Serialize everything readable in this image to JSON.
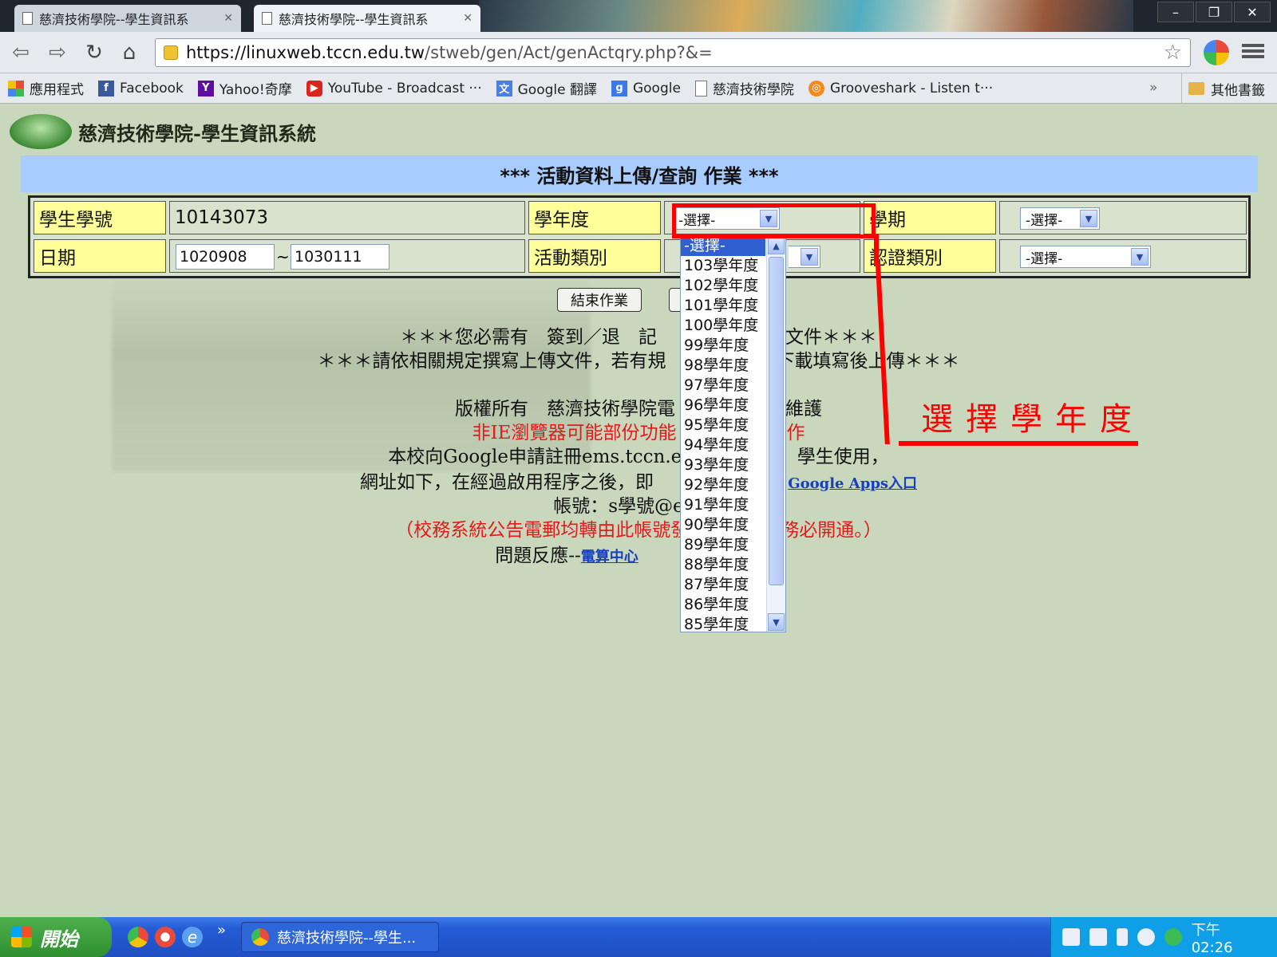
{
  "browser": {
    "tabs": [
      {
        "title": "慈濟技術學院--學生資訊系"
      },
      {
        "title": "慈濟技術學院--學生資訊系"
      }
    ],
    "window_controls": {
      "minimize": "–",
      "restore": "❐",
      "close": "✕"
    },
    "url_host": "https://linuxweb.tccn.edu.tw",
    "url_path": "/stweb/gen/Act/genActqry.php?&=",
    "bookmarks": [
      {
        "label": "應用程式",
        "icon": "apps-icon"
      },
      {
        "label": "Facebook",
        "icon": "facebook-icon"
      },
      {
        "label": "Yahoo!奇摩",
        "icon": "yahoo-icon"
      },
      {
        "label": "YouTube - Broadcast ···",
        "icon": "youtube-icon"
      },
      {
        "label": "Google 翻譯",
        "icon": "google-translate-icon"
      },
      {
        "label": "Google",
        "icon": "google-icon"
      },
      {
        "label": "慈濟技術學院",
        "icon": "page-icon"
      },
      {
        "label": "Grooveshark - Listen t···",
        "icon": "grooveshark-icon"
      }
    ],
    "bookmarks_more": "»",
    "other_bookmarks": "其他書籤"
  },
  "page": {
    "site_title": "慈濟技術學院-學生資訊系統",
    "banner": "*** 活動資料上傳/查詢 作業 ***",
    "form": {
      "student_id_label": "學生學號",
      "student_id_value": "10143073",
      "year_label": "學年度",
      "year_select": "-選擇-",
      "semester_label": "學期",
      "semester_select": "-選擇-",
      "date_label": "日期",
      "date_from": "1020908",
      "date_sep": "~",
      "date_to": "1030111",
      "activity_label": "活動類別",
      "cert_label": "認證類別",
      "cert_select": "-選擇-"
    },
    "end_button": "結束作業",
    "lines": {
      "l1": "＊＊＊您必需有　簽到／退　記　　　　　　　文件＊＊＊",
      "l2": "＊＊＊請依相關規定撰寫上傳文件，若有規　　　　　　下載填寫後上傳＊＊＊",
      "l3": "版權所有　慈濟技術學院電　　　　　　維護",
      "l4": "非IE瀏覽器可能部份功能　　　　　　作",
      "l5": "本校向Google申請註冊ems.tccn.edu　　　　　學生使用，",
      "l6": "網址如下，在經過啟用程序之後，即　　　　　　，",
      "l6_link": "Google Apps入口",
      "l7": "帳號：s學號@ems.t",
      "l8": "（校務系統公告電郵均轉由此帳號發　　　　　務必開通。）",
      "l9": "問題反應--",
      "l9_link": "電算中心"
    },
    "dropdown_options": [
      "-選擇-",
      "103學年度",
      "102學年度",
      "101學年度",
      "100學年度",
      "99學年度",
      "98學年度",
      "97學年度",
      "96學年度",
      "95學年度",
      "94學年度",
      "93學年度",
      "92學年度",
      "91學年度",
      "90學年度",
      "89學年度",
      "88學年度",
      "87學年度",
      "86學年度",
      "85學年度"
    ],
    "annotation": "選擇學年度"
  },
  "taskbar": {
    "start": "開始",
    "task": "慈濟技術學院--學生...",
    "ql_more": "»",
    "clock": "下午 02:26"
  },
  "colors": {
    "page_bg": "#c9d8bd",
    "banner_bg": "#a9ccff",
    "label_bg": "#ffff99",
    "annotation": "#ff0000",
    "selected_option": "#2f5fd0"
  }
}
